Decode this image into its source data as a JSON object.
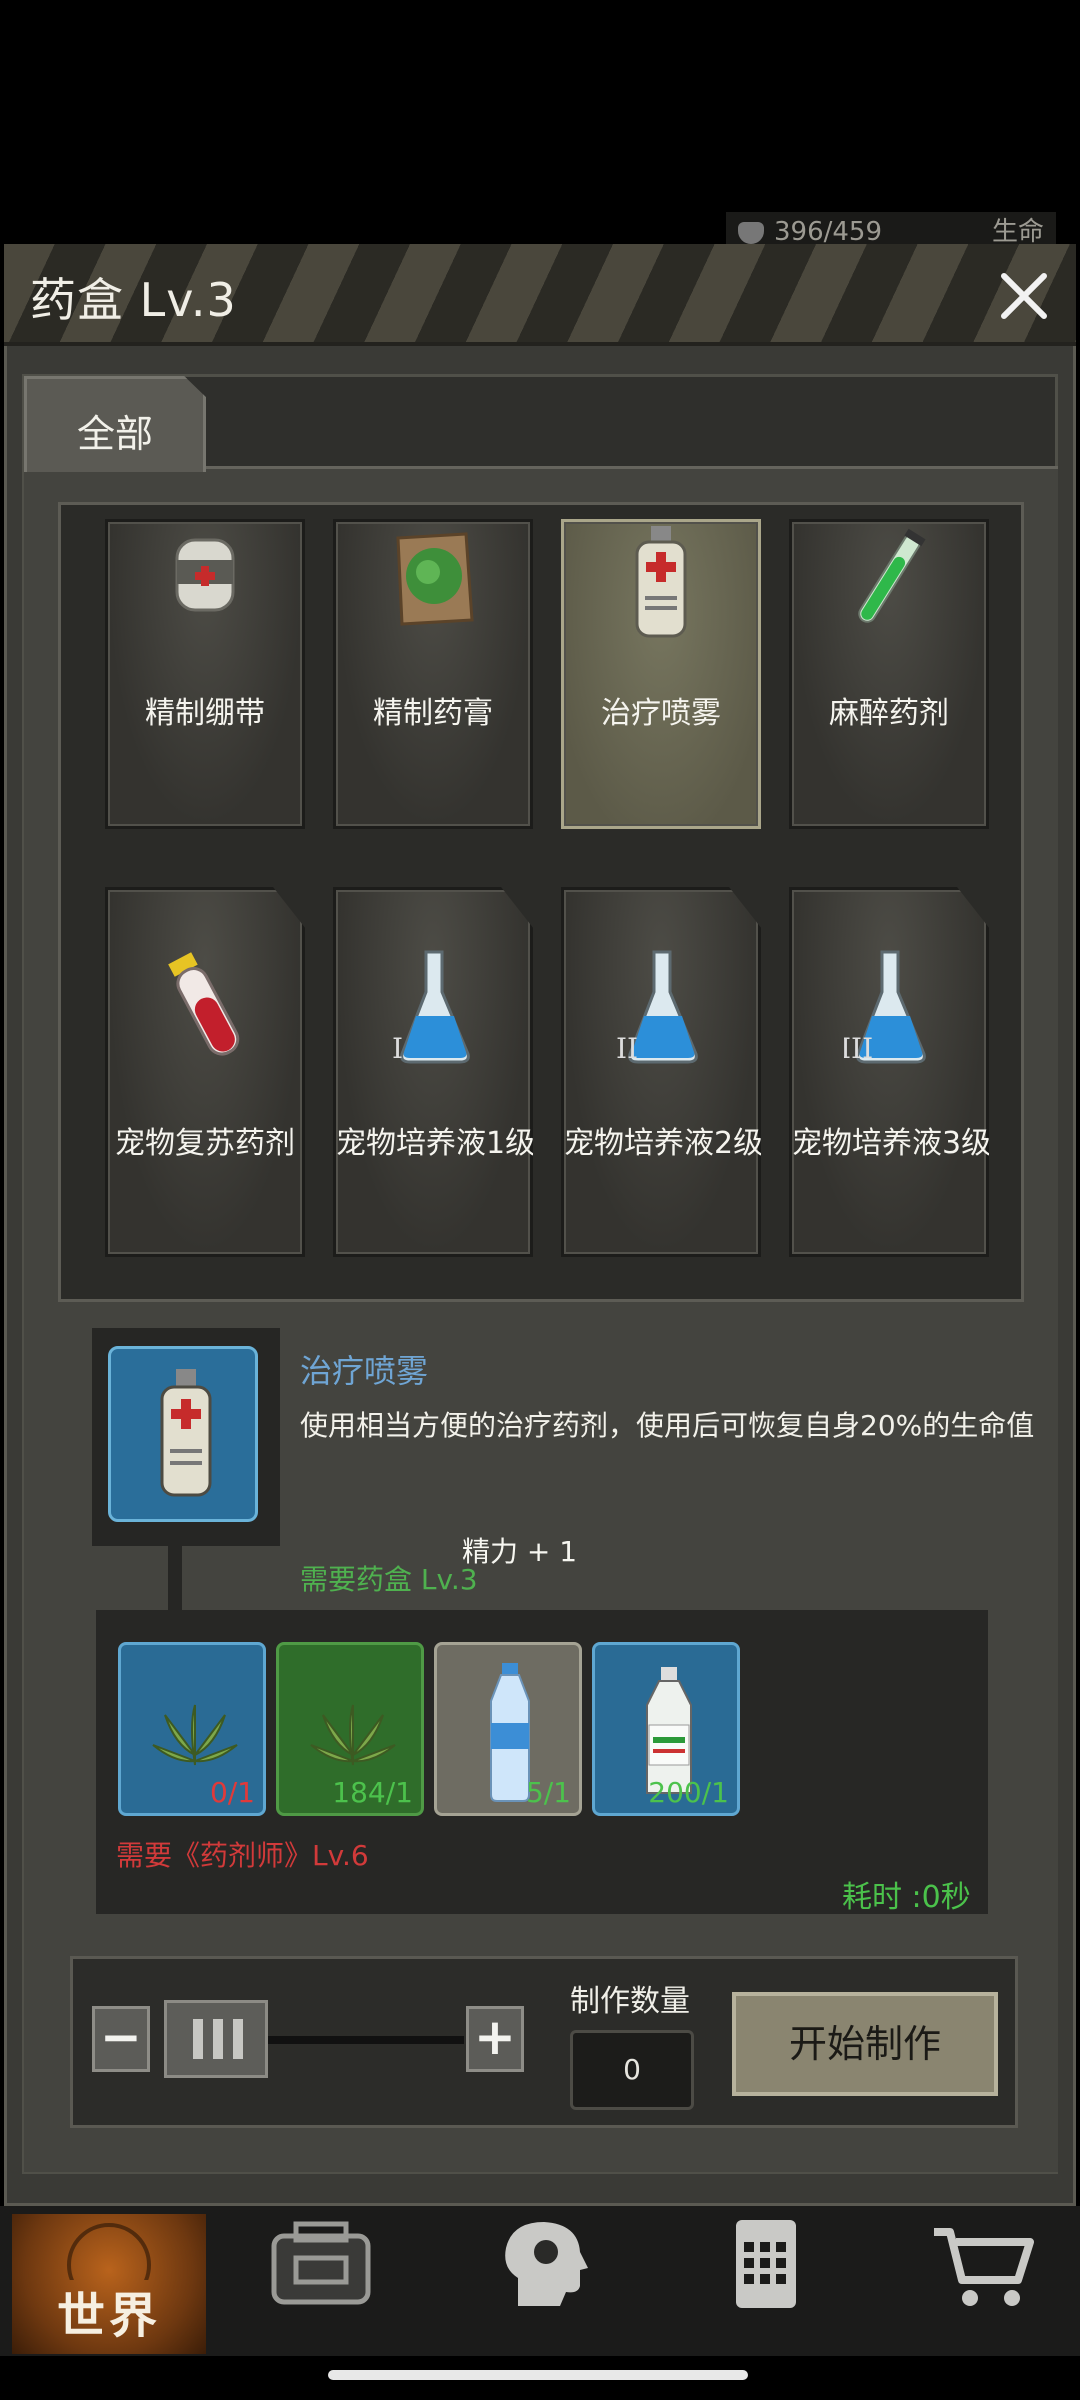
{
  "status_bar": {
    "health_text": "396/459",
    "health_label": "生命"
  },
  "window": {
    "title": "药盒 Lv.3",
    "close_icon": "close-icon"
  },
  "tabs": [
    {
      "label": "全部",
      "active": true
    }
  ],
  "recipes": [
    {
      "label": "精制绷带",
      "icon": "bandage-icon"
    },
    {
      "label": "精制药膏",
      "icon": "ointment-icon"
    },
    {
      "label": "治疗喷雾",
      "icon": "spray-bottle-icon",
      "selected": true
    },
    {
      "label": "麻醉药剂",
      "icon": "test-tube-icon"
    },
    {
      "label": "宠物复苏药剂",
      "icon": "vial-icon"
    },
    {
      "label": "宠物培养液1级",
      "icon": "flask-icon",
      "numeral": "I"
    },
    {
      "label": "宠物培养液2级",
      "icon": "flask-icon",
      "numeral": "II"
    },
    {
      "label": "宠物培养液3级",
      "icon": "flask-icon",
      "numeral": "III"
    }
  ],
  "detail": {
    "name": "治疗喷雾",
    "description": "使用相当方便的治疗药剂，使用后可恢复自身20%的生命值",
    "energy": "精力 + 1",
    "requirement": "需要药盒 Lv.3",
    "skill_requirement": "需要《药剂师》Lv.6",
    "time": "耗时 :0秒"
  },
  "materials": [
    {
      "icon": "herb-leaf-icon",
      "count": "0/1",
      "count_color": "#e03a3a",
      "bg": "blue"
    },
    {
      "icon": "herb-leaf-icon",
      "count": "184/1",
      "count_color": "#4cc24c",
      "bg": "green"
    },
    {
      "icon": "water-bottle-icon",
      "count": "5/1",
      "count_color": "#4cc24c",
      "bg": "grey"
    },
    {
      "icon": "alcohol-bottle-icon",
      "count": "200/1",
      "count_color": "#4cc24c",
      "bg": "blue"
    }
  ],
  "quantity": {
    "label": "制作数量",
    "value": "0",
    "minus": "−",
    "plus": "+"
  },
  "start_button": "开始制作",
  "bottom_nav": [
    {
      "label": "世界",
      "icon": "globe-icon",
      "active": true
    },
    {
      "icon": "backpack-icon"
    },
    {
      "icon": "head-icon"
    },
    {
      "icon": "calculator-icon"
    },
    {
      "icon": "shopping-cart-icon"
    }
  ]
}
